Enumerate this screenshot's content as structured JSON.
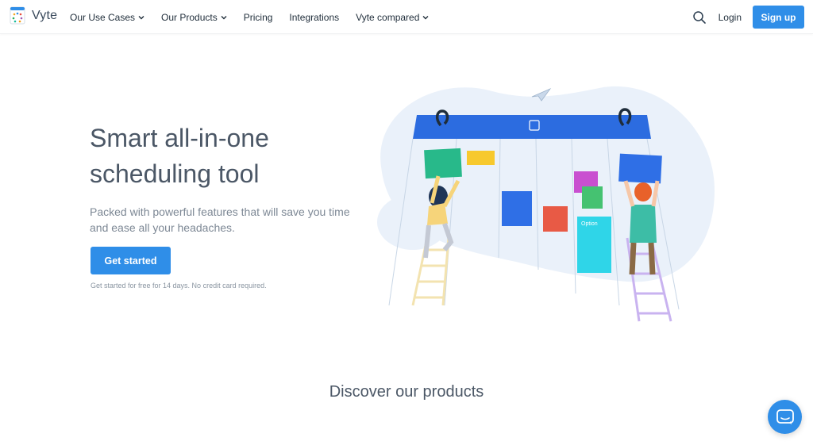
{
  "brand": {
    "name": "Vyte",
    "logo_icon": "vyte-logo-icon"
  },
  "nav": {
    "items": [
      {
        "label": "Our Use Cases",
        "dropdown": true
      },
      {
        "label": "Our Products",
        "dropdown": true
      },
      {
        "label": "Pricing",
        "dropdown": false
      },
      {
        "label": "Integrations",
        "dropdown": false
      },
      {
        "label": "Vyte compared",
        "dropdown": true
      }
    ],
    "search_icon": "search-icon",
    "login_label": "Login",
    "signup_label": "Sign up"
  },
  "hero": {
    "title": "Smart all-in-one scheduling tool",
    "subtitle": "Packed with powerful features that will save you time and ease all your headaches.",
    "cta_label": "Get started",
    "note": "Get started for free for 14 days. No credit card required.",
    "illustration_note_label": "Option"
  },
  "sections": {
    "discover_title": "Discover our products"
  },
  "chat": {
    "icon": "chat-icon"
  },
  "colors": {
    "accent": "#2f8ee8",
    "calendar_header": "#2c6ce0"
  }
}
